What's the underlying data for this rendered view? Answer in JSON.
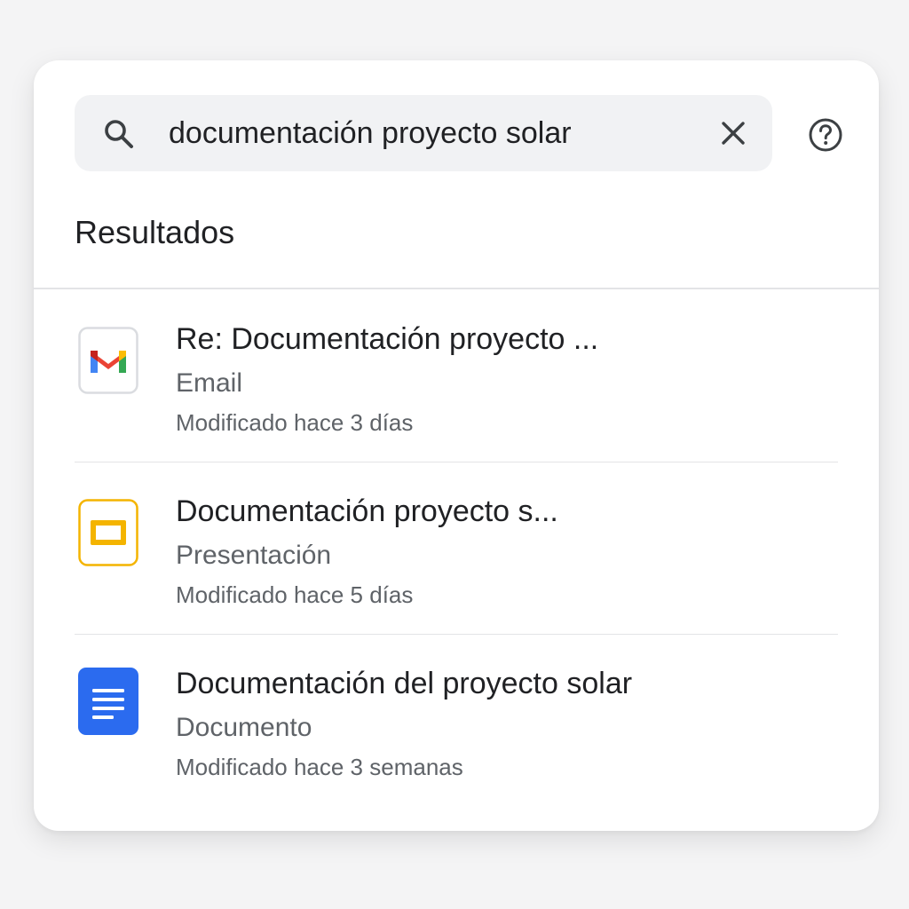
{
  "search": {
    "query": "documentación proyecto solar",
    "search_icon": "search-icon",
    "clear_icon": "close-icon",
    "help_icon": "help-circle-icon"
  },
  "section_title": "Resultados",
  "results": [
    {
      "title": "Re: Documentación proyecto ...",
      "type": "Email",
      "modified": "Modificado hace 3 días",
      "icon": "gmail-icon"
    },
    {
      "title": "Documentación proyecto s...",
      "type": "Presentación",
      "modified": "Modificado hace 5 días",
      "icon": "slides-icon"
    },
    {
      "title": "Documentación del proyecto solar",
      "type": "Documento",
      "modified": "Modificado hace 3 semanas",
      "icon": "docs-icon"
    }
  ],
  "colors": {
    "gmail_red": "#EA4335",
    "gmail_blue": "#4285F4",
    "gmail_green": "#34A853",
    "gmail_yellow": "#FBBC04",
    "slides_yellow": "#F4B400",
    "docs_blue": "#2B6BEF"
  }
}
